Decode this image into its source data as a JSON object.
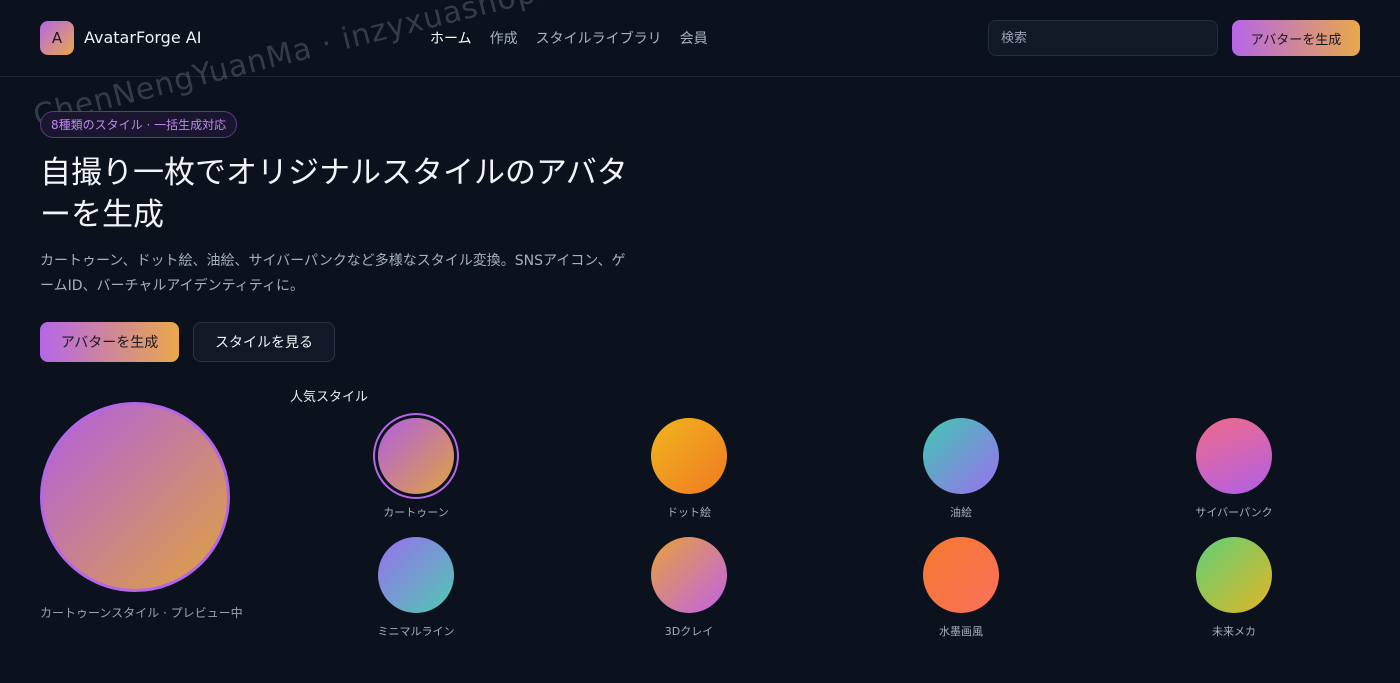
{
  "header": {
    "logo_letter": "A",
    "brand": "AvatarForge AI",
    "nav": [
      {
        "label": "ホーム",
        "active": true
      },
      {
        "label": "作成",
        "active": false
      },
      {
        "label": "スタイルライブラリ",
        "active": false
      },
      {
        "label": "会員",
        "active": false
      }
    ],
    "search_placeholder": "検索",
    "cta_label": "アバターを生成"
  },
  "watermark": "ChenNengYuanMa · inzyxuashop.com",
  "hero": {
    "badge": "8種類のスタイル · 一括生成対応",
    "title": "自撮り一枚でオリジナルスタイルのアバターを生成",
    "subtitle": "カートゥーン、ドット絵、油絵、サイバーパンクなど多様なスタイル変換。SNSアイコン、ゲームID、バーチャルアイデンティティに。",
    "primary_button": "アバターを生成",
    "secondary_button": "スタイルを見る"
  },
  "preview": {
    "caption": "カートゥーンスタイル · プレビュー中"
  },
  "styles_section": {
    "title": "人気スタイル",
    "items": [
      {
        "label": "カートゥーン",
        "selected": true
      },
      {
        "label": "ドット絵",
        "selected": false
      },
      {
        "label": "油絵",
        "selected": false
      },
      {
        "label": "サイバーパンク",
        "selected": false
      },
      {
        "label": "ミニマルライン",
        "selected": false
      },
      {
        "label": "3Dクレイ",
        "selected": false
      },
      {
        "label": "水墨画風",
        "selected": false
      },
      {
        "label": "未来メカ",
        "selected": false
      }
    ]
  },
  "colors": {
    "accent_start": "#b566e8",
    "accent_end": "#e9a84a",
    "background": "#0b111d"
  }
}
